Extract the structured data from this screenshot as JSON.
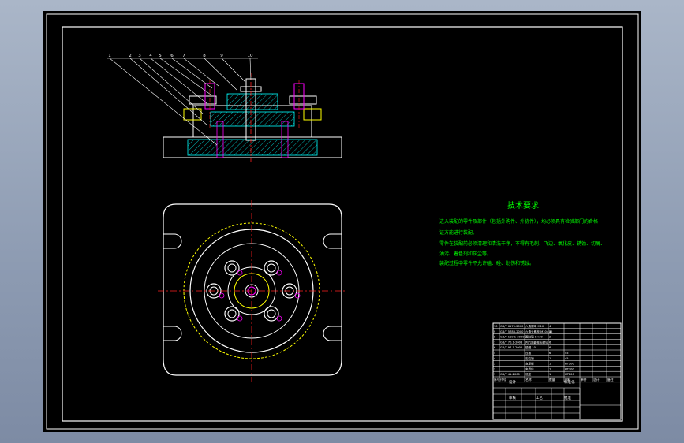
{
  "drawing": {
    "title": "技术要求",
    "requirements": [
      "进入装配的零件及部件（包括外购件、外协件），均必须具有检验部门的合格",
      "证方能进行装配。",
      "零件在装配前必须清理和清洗干净，不得有毛刺、飞边、氧化皮、锈蚀、切屑、",
      "油污、着色剂和灰尘等。",
      "装配过程中零件不允许磕、碰、划伤和锈蚀。"
    ],
    "balloons": [
      "1",
      "2",
      "3",
      "4",
      "5",
      "6",
      "7",
      "8",
      "9",
      "10"
    ]
  },
  "title_block": {
    "header": [
      "序号",
      "代号",
      "名称",
      "数量",
      "材料",
      "单件",
      "总计",
      "备注"
    ],
    "parts": [
      [
        "10",
        "GB/T 6170-2000",
        "六角螺母 M10",
        "4",
        "",
        "",
        "",
        ""
      ],
      [
        "9",
        "GB/T 5783-2000",
        "六角头螺栓 M10×35",
        "4",
        "",
        "",
        "",
        ""
      ],
      [
        "8",
        "GB/T 119.1-2000",
        "圆柱销 8×30",
        "2",
        "",
        "",
        "",
        ""
      ],
      [
        "7",
        "GB/T 70.1-2008",
        "内六角圆柱头螺钉",
        "6",
        "",
        "",
        "",
        ""
      ],
      [
        "6",
        "GB/T 97.1-2002",
        "垫圈 10",
        "6",
        "",
        "",
        "",
        ""
      ],
      [
        "5",
        "",
        "压板",
        "6",
        "45",
        "",
        "",
        ""
      ],
      [
        "4",
        "",
        "定位销",
        "1",
        "45",
        "",
        "",
        ""
      ],
      [
        "3",
        "",
        "支承板",
        "1",
        "HT200",
        "",
        "",
        ""
      ],
      [
        "2",
        "",
        "夹具体",
        "1",
        "HT200",
        "",
        "",
        ""
      ],
      [
        "1",
        "GB/T 41-2000",
        "底座",
        "1",
        "HT200",
        "",
        "",
        ""
      ]
    ],
    "designer_row": [
      "设计",
      "",
      "标准化",
      "",
      "",
      ""
    ],
    "review_row": [
      "审核",
      "",
      "工艺",
      "",
      "批准",
      ""
    ]
  },
  "colors": {
    "background": "#000000",
    "outline": "#ffffff",
    "center_line": "#ff2020",
    "hatch": "#00ffff",
    "hidden": "#ffff00",
    "text": "#00ff00",
    "accent": "#ff00ff"
  }
}
